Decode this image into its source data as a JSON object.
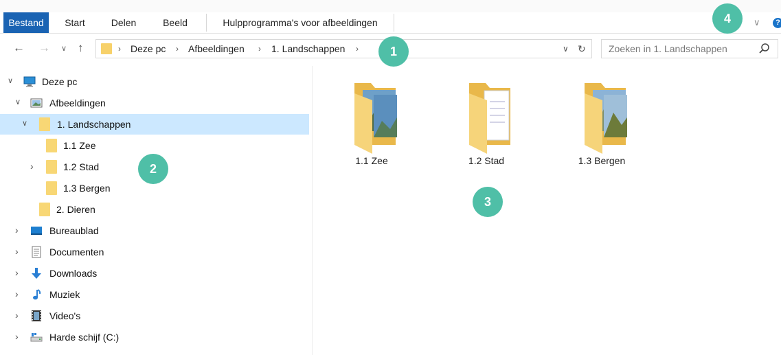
{
  "ribbon": {
    "tabs": [
      "Bestand",
      "Start",
      "Delen",
      "Beeld"
    ],
    "tools_tab": "Hulpprogramma's voor afbeeldingen",
    "help_icon": "help-icon",
    "help_glyph": "?"
  },
  "address": {
    "breadcrumbs": [
      "Deze pc",
      "Afbeeldingen",
      "1. Landschappen"
    ],
    "separator": "›",
    "dropdown_glyph": "∨",
    "refresh_glyph": "↻"
  },
  "search": {
    "placeholder": "Zoeken in 1. Landschappen"
  },
  "nav": {
    "back": "←",
    "forward": "→",
    "recent": "∨",
    "up": "↑"
  },
  "tree": {
    "items": [
      {
        "label": "Deze pc",
        "icon": "computer-icon"
      },
      {
        "label": "Afbeeldingen",
        "icon": "pictures-icon"
      },
      {
        "label": "1. Landschappen",
        "icon": "folder-icon",
        "selected": true
      },
      {
        "label": "1.1 Zee",
        "icon": "folder-icon"
      },
      {
        "label": "1.2 Stad",
        "icon": "folder-icon"
      },
      {
        "label": "1.3 Bergen",
        "icon": "folder-icon"
      },
      {
        "label": "2. Dieren",
        "icon": "folder-icon"
      },
      {
        "label": "Bureaublad",
        "icon": "desktop-icon"
      },
      {
        "label": "Documenten",
        "icon": "documents-icon"
      },
      {
        "label": "Downloads",
        "icon": "downloads-icon"
      },
      {
        "label": "Muziek",
        "icon": "music-icon"
      },
      {
        "label": "Video's",
        "icon": "videos-icon"
      },
      {
        "label": "Harde schijf (C:)",
        "icon": "drive-icon"
      }
    ],
    "expanded_glyph": "∨",
    "collapsed_glyph": "›"
  },
  "content": {
    "folders": [
      {
        "label": "1.1 Zee",
        "icon": "folder-with-photos-icon"
      },
      {
        "label": "1.2 Stad",
        "icon": "folder-with-documents-icon"
      },
      {
        "label": "1.3 Bergen",
        "icon": "folder-with-photos-icon"
      }
    ]
  },
  "callouts": [
    "1",
    "2",
    "3",
    "4"
  ],
  "colors": {
    "accent": "#1a63b3",
    "selection": "#cce8ff",
    "callout": "#4fbfa7",
    "folder": "#f8d775"
  }
}
